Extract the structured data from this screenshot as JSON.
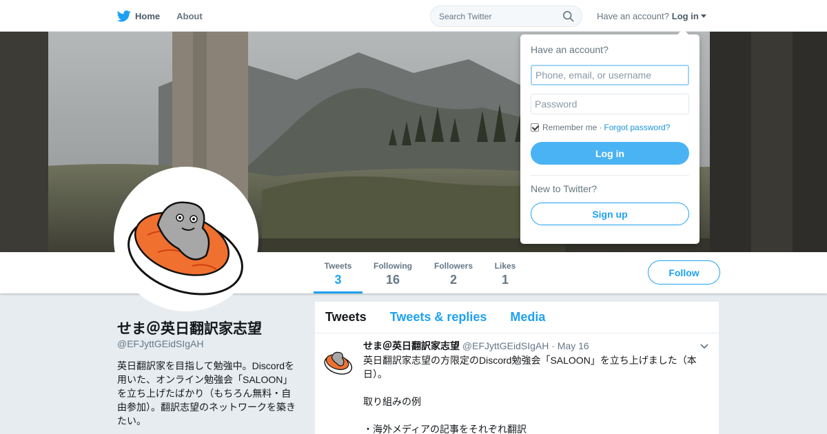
{
  "topbar": {
    "home_label": "Home",
    "about_label": "About",
    "search_placeholder": "Search Twitter",
    "have_account": "Have an account?",
    "login_label": "Log in"
  },
  "profile": {
    "name": "せま＠英日翻訳家志望",
    "handle": "@EFJyttGEidSIgAH",
    "bio": "英日翻訳家を目指して勉強中。Discordを用いた、オンライン勉強会「SALOON」を立ち上げたばかり（もちろん無料・自由参加）。翻訳志望のネットワークを築きたい。"
  },
  "stats": [
    {
      "label": "Tweets",
      "value": "3"
    },
    {
      "label": "Following",
      "value": "16"
    },
    {
      "label": "Followers",
      "value": "2"
    },
    {
      "label": "Likes",
      "value": "1"
    }
  ],
  "follow_label": "Follow",
  "timeline": {
    "tabs": [
      "Tweets",
      "Tweets & replies",
      "Media"
    ],
    "tweet": {
      "name": "せま＠英日翻訳家志望",
      "handle": "@EFJyttGEidSIgAH",
      "date": "· May 16",
      "lines": [
        "英日翻訳家志望の方限定のDiscord勉強会「SALOON」を立ち上げました（本日）。",
        "",
        "取り組みの例",
        "",
        "・海外メディアの記事をそれぞれ翻訳"
      ]
    }
  },
  "login_dropdown": {
    "title": "Have an account?",
    "username_placeholder": "Phone, email, or username",
    "password_placeholder": "Password",
    "remember": "Remember me",
    "dot": "·",
    "forgot": "Forgot password?",
    "login_button": "Log in",
    "new_to": "New to Twitter?",
    "signup_button": "Sign up"
  },
  "colors": {
    "accent": "#1da1f2",
    "login_button": "#4ab3f4",
    "page_bg": "#e6ecf0"
  }
}
